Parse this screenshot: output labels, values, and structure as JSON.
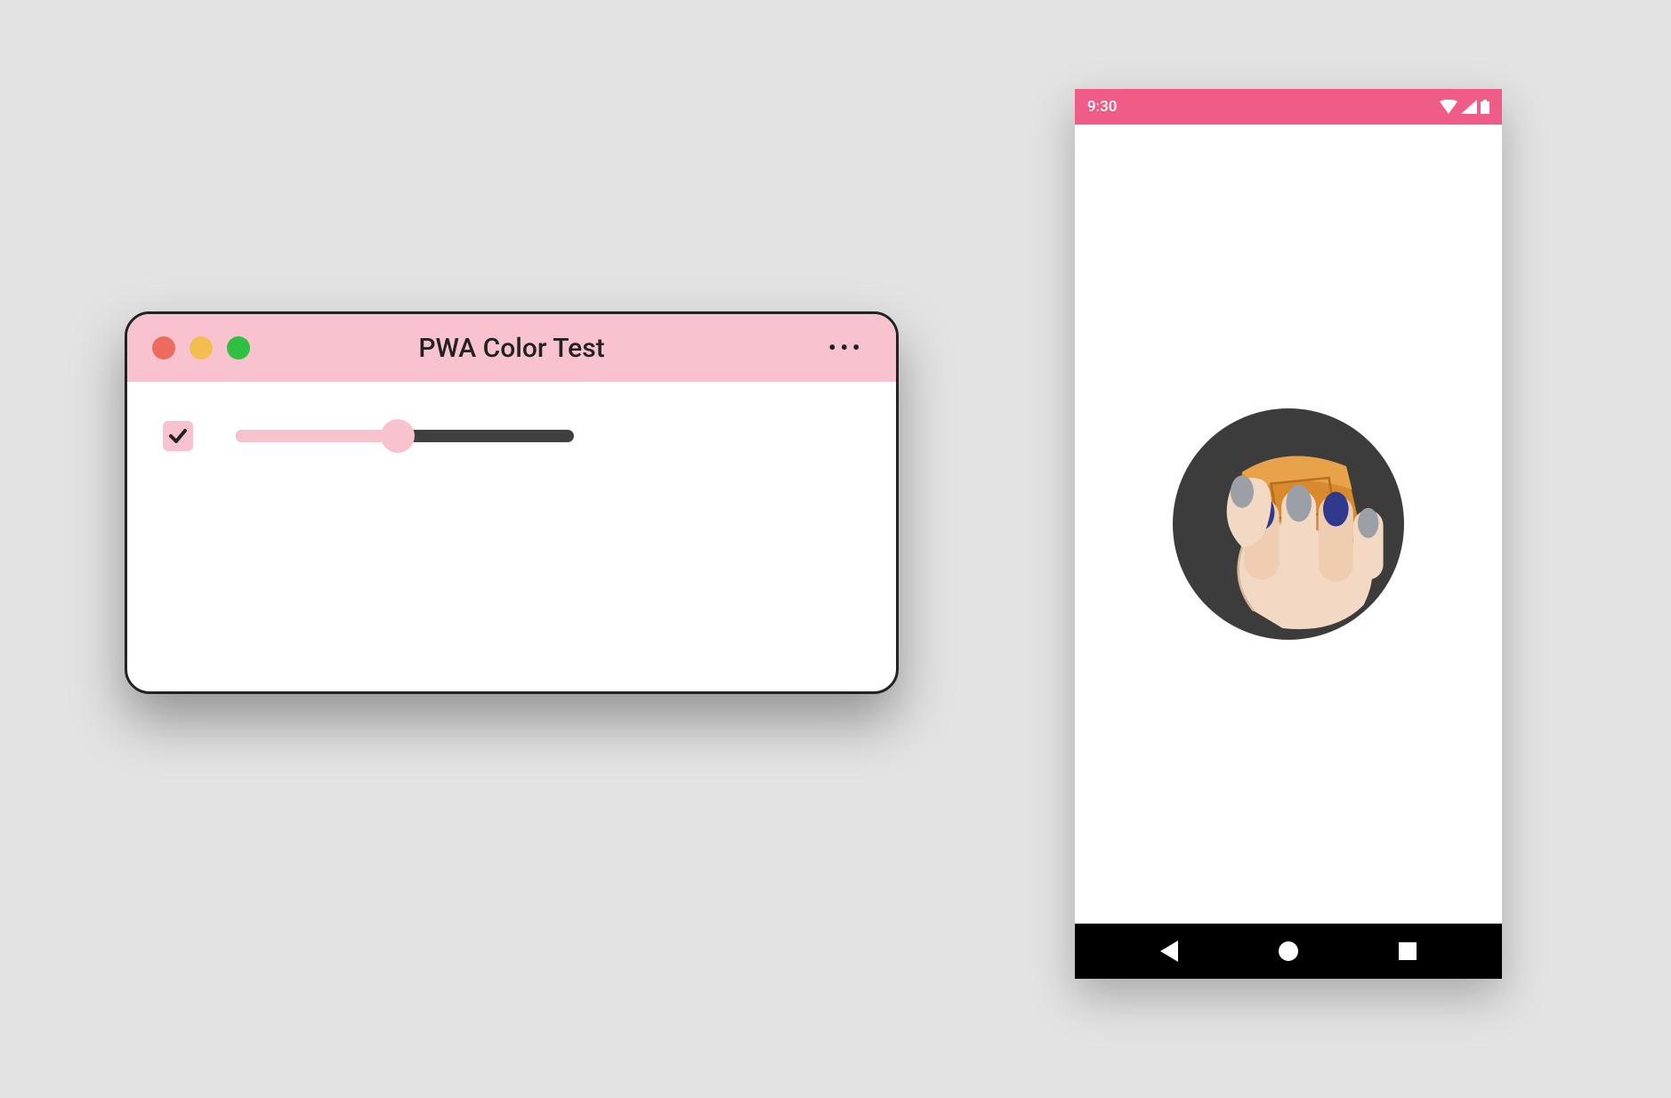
{
  "colors": {
    "theme_pink_light": "#f8c3cf",
    "theme_pink": "#ee5c87",
    "track_dark": "#3f3f3f"
  },
  "desktop": {
    "title": "PWA Color Test",
    "more_icon": "more-horizontal-icon",
    "traffic_lights": [
      "close",
      "minimize",
      "maximize"
    ],
    "checkbox_checked": true,
    "slider_percent": 48
  },
  "phone": {
    "status_time": "9:30",
    "status_icons": [
      "wifi-icon",
      "signal-icon",
      "battery-icon"
    ],
    "splash_icon_name": "hand-crushing-icon",
    "nav": [
      "back",
      "home",
      "recent"
    ]
  }
}
